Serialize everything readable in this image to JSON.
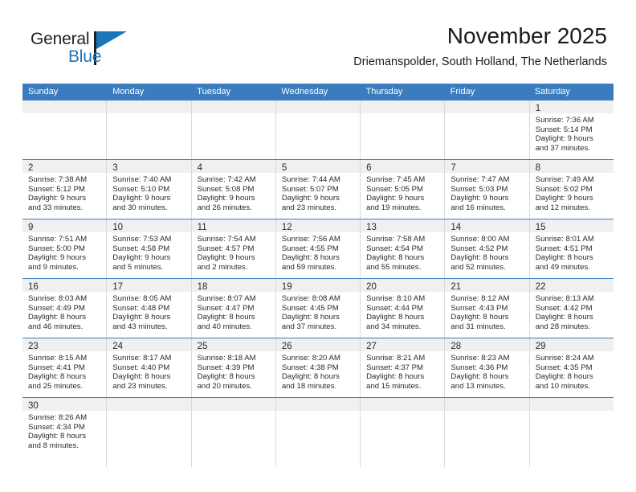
{
  "logo": {
    "word_one": "General",
    "word_two": "Blue",
    "accent_color": "#1b75bb",
    "triangle_icon": "triangle-icon"
  },
  "header": {
    "title": "November 2025",
    "subtitle": "Driemanspolder, South Holland, The Netherlands"
  },
  "colors": {
    "header_blue": "#3a7cbe",
    "daynum_band": "#f0f0f0",
    "cell_border": "#d9d9d9",
    "text": "#2b2b2b"
  },
  "weekdays": [
    "Sunday",
    "Monday",
    "Tuesday",
    "Wednesday",
    "Thursday",
    "Friday",
    "Saturday"
  ],
  "weeks": [
    [
      {
        "empty": true
      },
      {
        "empty": true
      },
      {
        "empty": true
      },
      {
        "empty": true
      },
      {
        "empty": true
      },
      {
        "empty": true
      },
      {
        "day": "1",
        "sunrise": "Sunrise: 7:36 AM",
        "sunset": "Sunset: 5:14 PM",
        "daylight_1": "Daylight: 9 hours",
        "daylight_2": "and 37 minutes."
      }
    ],
    [
      {
        "day": "2",
        "sunrise": "Sunrise: 7:38 AM",
        "sunset": "Sunset: 5:12 PM",
        "daylight_1": "Daylight: 9 hours",
        "daylight_2": "and 33 minutes."
      },
      {
        "day": "3",
        "sunrise": "Sunrise: 7:40 AM",
        "sunset": "Sunset: 5:10 PM",
        "daylight_1": "Daylight: 9 hours",
        "daylight_2": "and 30 minutes."
      },
      {
        "day": "4",
        "sunrise": "Sunrise: 7:42 AM",
        "sunset": "Sunset: 5:08 PM",
        "daylight_1": "Daylight: 9 hours",
        "daylight_2": "and 26 minutes."
      },
      {
        "day": "5",
        "sunrise": "Sunrise: 7:44 AM",
        "sunset": "Sunset: 5:07 PM",
        "daylight_1": "Daylight: 9 hours",
        "daylight_2": "and 23 minutes."
      },
      {
        "day": "6",
        "sunrise": "Sunrise: 7:45 AM",
        "sunset": "Sunset: 5:05 PM",
        "daylight_1": "Daylight: 9 hours",
        "daylight_2": "and 19 minutes."
      },
      {
        "day": "7",
        "sunrise": "Sunrise: 7:47 AM",
        "sunset": "Sunset: 5:03 PM",
        "daylight_1": "Daylight: 9 hours",
        "daylight_2": "and 16 minutes."
      },
      {
        "day": "8",
        "sunrise": "Sunrise: 7:49 AM",
        "sunset": "Sunset: 5:02 PM",
        "daylight_1": "Daylight: 9 hours",
        "daylight_2": "and 12 minutes."
      }
    ],
    [
      {
        "day": "9",
        "sunrise": "Sunrise: 7:51 AM",
        "sunset": "Sunset: 5:00 PM",
        "daylight_1": "Daylight: 9 hours",
        "daylight_2": "and 9 minutes."
      },
      {
        "day": "10",
        "sunrise": "Sunrise: 7:53 AM",
        "sunset": "Sunset: 4:58 PM",
        "daylight_1": "Daylight: 9 hours",
        "daylight_2": "and 5 minutes."
      },
      {
        "day": "11",
        "sunrise": "Sunrise: 7:54 AM",
        "sunset": "Sunset: 4:57 PM",
        "daylight_1": "Daylight: 9 hours",
        "daylight_2": "and 2 minutes."
      },
      {
        "day": "12",
        "sunrise": "Sunrise: 7:56 AM",
        "sunset": "Sunset: 4:55 PM",
        "daylight_1": "Daylight: 8 hours",
        "daylight_2": "and 59 minutes."
      },
      {
        "day": "13",
        "sunrise": "Sunrise: 7:58 AM",
        "sunset": "Sunset: 4:54 PM",
        "daylight_1": "Daylight: 8 hours",
        "daylight_2": "and 55 minutes."
      },
      {
        "day": "14",
        "sunrise": "Sunrise: 8:00 AM",
        "sunset": "Sunset: 4:52 PM",
        "daylight_1": "Daylight: 8 hours",
        "daylight_2": "and 52 minutes."
      },
      {
        "day": "15",
        "sunrise": "Sunrise: 8:01 AM",
        "sunset": "Sunset: 4:51 PM",
        "daylight_1": "Daylight: 8 hours",
        "daylight_2": "and 49 minutes."
      }
    ],
    [
      {
        "day": "16",
        "sunrise": "Sunrise: 8:03 AM",
        "sunset": "Sunset: 4:49 PM",
        "daylight_1": "Daylight: 8 hours",
        "daylight_2": "and 46 minutes."
      },
      {
        "day": "17",
        "sunrise": "Sunrise: 8:05 AM",
        "sunset": "Sunset: 4:48 PM",
        "daylight_1": "Daylight: 8 hours",
        "daylight_2": "and 43 minutes."
      },
      {
        "day": "18",
        "sunrise": "Sunrise: 8:07 AM",
        "sunset": "Sunset: 4:47 PM",
        "daylight_1": "Daylight: 8 hours",
        "daylight_2": "and 40 minutes."
      },
      {
        "day": "19",
        "sunrise": "Sunrise: 8:08 AM",
        "sunset": "Sunset: 4:45 PM",
        "daylight_1": "Daylight: 8 hours",
        "daylight_2": "and 37 minutes."
      },
      {
        "day": "20",
        "sunrise": "Sunrise: 8:10 AM",
        "sunset": "Sunset: 4:44 PM",
        "daylight_1": "Daylight: 8 hours",
        "daylight_2": "and 34 minutes."
      },
      {
        "day": "21",
        "sunrise": "Sunrise: 8:12 AM",
        "sunset": "Sunset: 4:43 PM",
        "daylight_1": "Daylight: 8 hours",
        "daylight_2": "and 31 minutes."
      },
      {
        "day": "22",
        "sunrise": "Sunrise: 8:13 AM",
        "sunset": "Sunset: 4:42 PM",
        "daylight_1": "Daylight: 8 hours",
        "daylight_2": "and 28 minutes."
      }
    ],
    [
      {
        "day": "23",
        "sunrise": "Sunrise: 8:15 AM",
        "sunset": "Sunset: 4:41 PM",
        "daylight_1": "Daylight: 8 hours",
        "daylight_2": "and 25 minutes."
      },
      {
        "day": "24",
        "sunrise": "Sunrise: 8:17 AM",
        "sunset": "Sunset: 4:40 PM",
        "daylight_1": "Daylight: 8 hours",
        "daylight_2": "and 23 minutes."
      },
      {
        "day": "25",
        "sunrise": "Sunrise: 8:18 AM",
        "sunset": "Sunset: 4:39 PM",
        "daylight_1": "Daylight: 8 hours",
        "daylight_2": "and 20 minutes."
      },
      {
        "day": "26",
        "sunrise": "Sunrise: 8:20 AM",
        "sunset": "Sunset: 4:38 PM",
        "daylight_1": "Daylight: 8 hours",
        "daylight_2": "and 18 minutes."
      },
      {
        "day": "27",
        "sunrise": "Sunrise: 8:21 AM",
        "sunset": "Sunset: 4:37 PM",
        "daylight_1": "Daylight: 8 hours",
        "daylight_2": "and 15 minutes."
      },
      {
        "day": "28",
        "sunrise": "Sunrise: 8:23 AM",
        "sunset": "Sunset: 4:36 PM",
        "daylight_1": "Daylight: 8 hours",
        "daylight_2": "and 13 minutes."
      },
      {
        "day": "29",
        "sunrise": "Sunrise: 8:24 AM",
        "sunset": "Sunset: 4:35 PM",
        "daylight_1": "Daylight: 8 hours",
        "daylight_2": "and 10 minutes."
      }
    ],
    [
      {
        "day": "30",
        "sunrise": "Sunrise: 8:26 AM",
        "sunset": "Sunset: 4:34 PM",
        "daylight_1": "Daylight: 8 hours",
        "daylight_2": "and 8 minutes."
      },
      {
        "empty": true
      },
      {
        "empty": true
      },
      {
        "empty": true
      },
      {
        "empty": true
      },
      {
        "empty": true
      },
      {
        "empty": true
      }
    ]
  ]
}
